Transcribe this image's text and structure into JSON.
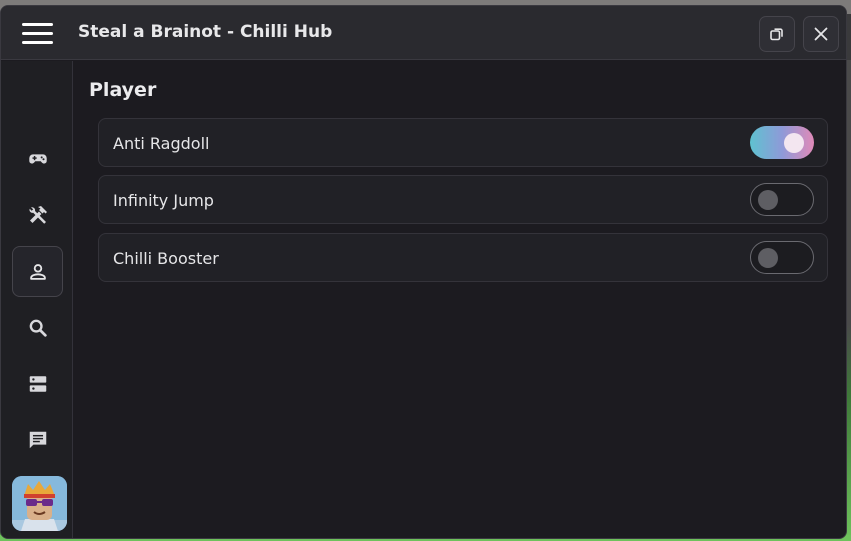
{
  "window": {
    "title": "Steal a Brainot - Chilli Hub",
    "buttons": {
      "menu_icon": "hamburger-icon",
      "restore_icon": "restore-icon",
      "close_icon": "close-icon"
    }
  },
  "sidebar": {
    "items": [
      {
        "id": "game",
        "icon": "gamepad-icon",
        "active": false
      },
      {
        "id": "tools",
        "icon": "tools-icon",
        "active": false
      },
      {
        "id": "player",
        "icon": "person-icon",
        "active": true
      },
      {
        "id": "search",
        "icon": "search-icon",
        "active": false
      },
      {
        "id": "servers",
        "icon": "server-icon",
        "active": false
      },
      {
        "id": "chat",
        "icon": "chat-icon",
        "active": false
      }
    ],
    "avatar_icon": "user-avatar"
  },
  "main": {
    "section_title": "Player",
    "toggles": [
      {
        "label": "Anti Ragdoll",
        "on": true
      },
      {
        "label": "Infinity Jump",
        "on": false
      },
      {
        "label": "Chilli Booster",
        "on": false
      }
    ]
  },
  "colors": {
    "window_bg": "#1c1b20",
    "titlebar_bg": "#2a2a2f",
    "toggle_on_gradient": [
      "#5fc2d0",
      "#8e9ad8",
      "#e08ab8"
    ],
    "toggle_off_knob": "#5e5e63"
  }
}
